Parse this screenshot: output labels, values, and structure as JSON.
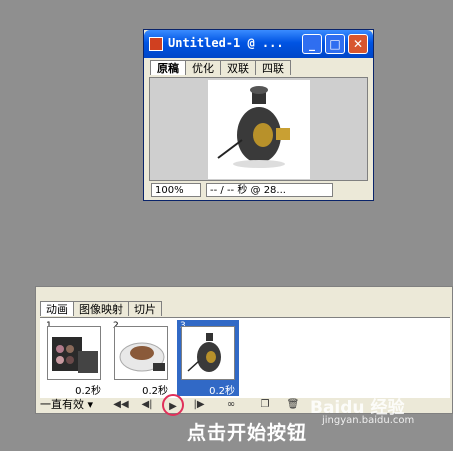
{
  "document_window": {
    "title": "Untitled-1 @ ...",
    "tabs": [
      "原稿",
      "优化",
      "双联",
      "四联"
    ],
    "zoom": "100%",
    "size_info": "-- / -- 秒 @ 28...",
    "buttons": {
      "minimize": "_",
      "maximize": "□",
      "close": "✕"
    }
  },
  "animation_panel": {
    "tabs": [
      "动画",
      "图像映射",
      "切片"
    ],
    "frames": [
      {
        "number": "1",
        "delay": "0.2秒"
      },
      {
        "number": "2",
        "delay": "0.2秒"
      },
      {
        "number": "3",
        "delay": "0.2秒"
      }
    ],
    "loop_option": "一直有效"
  },
  "caption": "点击开始按钮",
  "watermark": {
    "logo": "Baidu 经验",
    "url": "jingyan.baidu.com"
  }
}
